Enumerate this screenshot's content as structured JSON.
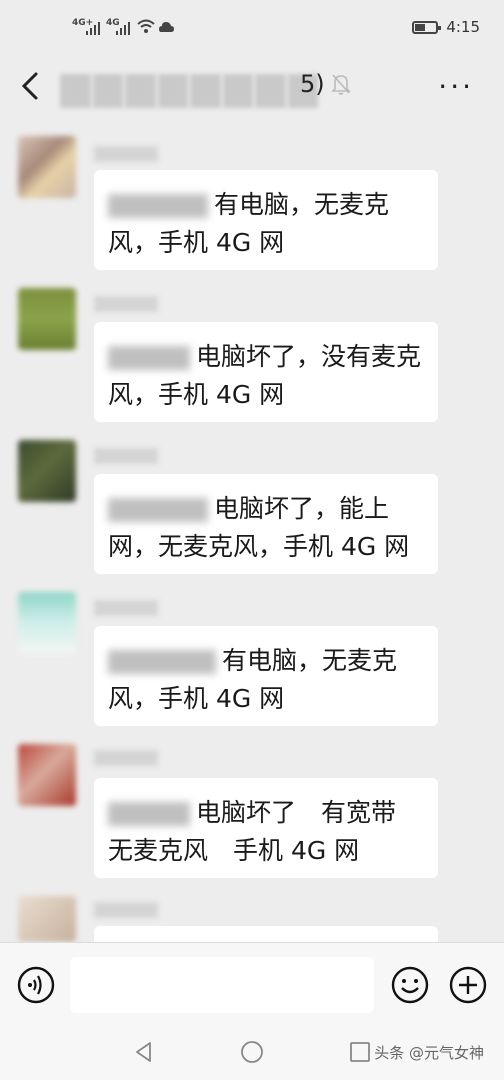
{
  "status_bar": {
    "time": "4:15",
    "sim1": "4G+",
    "sim2": "4G"
  },
  "header": {
    "title_suffix": "5)",
    "back_icon": "chevron-left-icon",
    "mute_icon": "bell-muted-icon",
    "more_label": "···"
  },
  "messages": [
    {
      "text": "有电脑，无麦克风，手机 4G 网"
    },
    {
      "text": "电脑坏了，没有麦克风，手机 4G 网"
    },
    {
      "text": "电脑坏了，能上网，无麦克风，手机 4G 网"
    },
    {
      "text": "有电脑，无麦克风，手机 4G 网"
    },
    {
      "text": "电脑坏了　有宽带　无麦克风　手机 4G 网"
    }
  ],
  "input_bar": {
    "voice_icon": "voice-icon",
    "emoji_icon": "emoji-icon",
    "plus_icon": "plus-icon",
    "placeholder": ""
  },
  "system_nav": {
    "watermark": "头条 @元气女神"
  }
}
